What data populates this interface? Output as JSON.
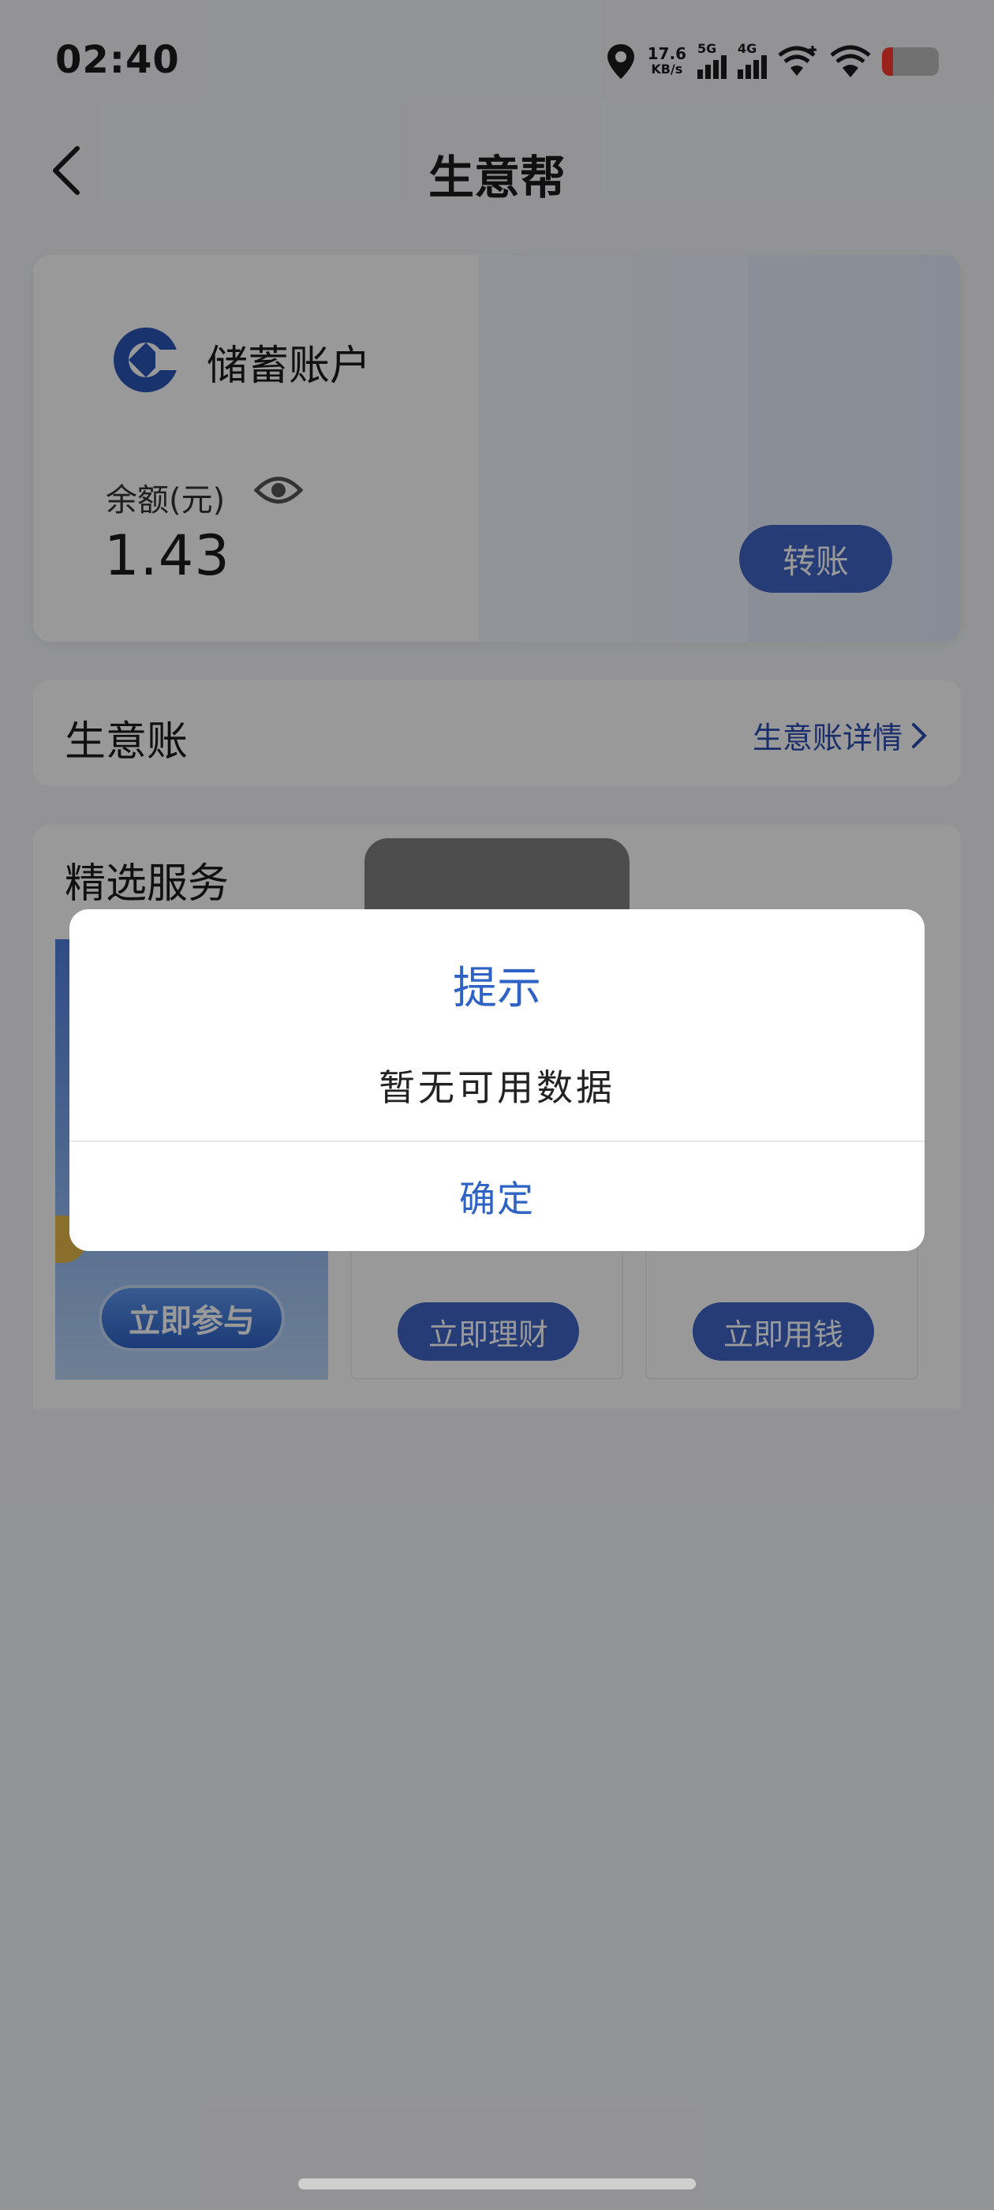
{
  "status_bar": {
    "time": "02:40",
    "net_speed_value": "17.6",
    "net_speed_unit": "KB/s",
    "sim1": "5G",
    "sim2": "4G",
    "battery_color": "#ff3b30"
  },
  "header": {
    "title": "生意帮",
    "back_icon": "chevron-left-icon"
  },
  "account_card": {
    "account_name": "储蓄账户",
    "balance_label": "余额(元)",
    "balance_value": "1.43",
    "transfer_label": "转账",
    "logo_icon": "bank-logo-icon",
    "eye_icon": "eye-icon"
  },
  "business_account": {
    "title": "生意账",
    "link_label": "生意账详情"
  },
  "services": {
    "title": "精选服务",
    "items": [
      {
        "button_label": "立即参与"
      },
      {
        "button_label": "立即理财"
      },
      {
        "button_label": "立即用钱"
      }
    ]
  },
  "dialog": {
    "title": "提示",
    "message": "暂无可用数据",
    "confirm_label": "确定"
  },
  "colors": {
    "accent": "#2f62c5",
    "button": "#3e64c7"
  }
}
